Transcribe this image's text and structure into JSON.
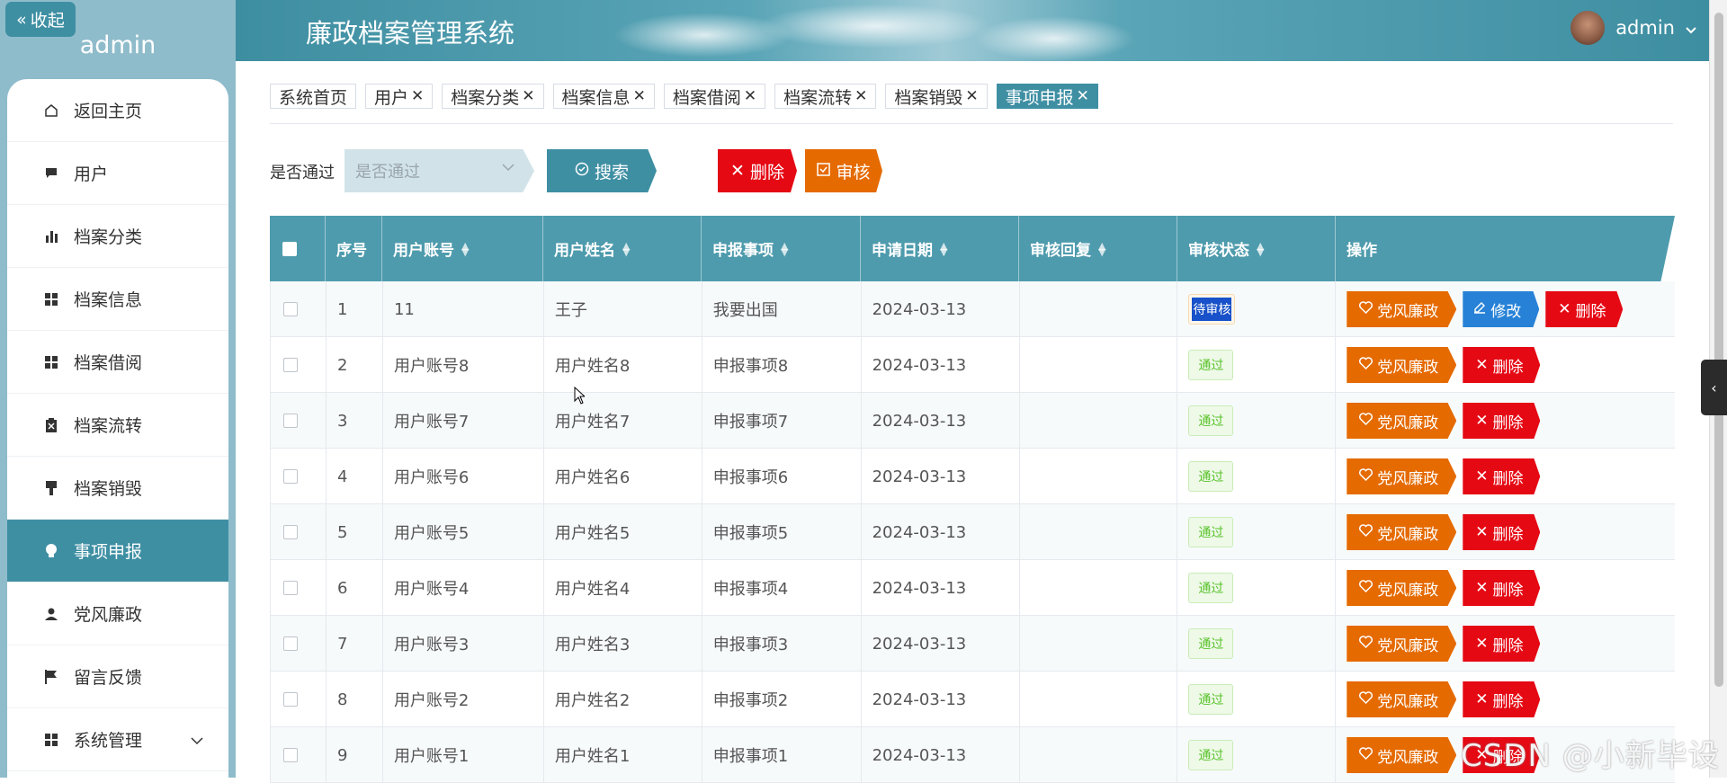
{
  "sidebar": {
    "collapse_label": "收起",
    "user_label": "admin",
    "items": [
      {
        "label": "返回主页",
        "icon": "home-icon"
      },
      {
        "label": "用户",
        "icon": "chat-icon"
      },
      {
        "label": "档案分类",
        "icon": "bar-chart-icon"
      },
      {
        "label": "档案信息",
        "icon": "grid-icon"
      },
      {
        "label": "档案借阅",
        "icon": "grid-icon"
      },
      {
        "label": "档案流转",
        "icon": "clipboard-icon"
      },
      {
        "label": "档案销毁",
        "icon": "brush-icon"
      },
      {
        "label": "事项申报",
        "icon": "lightbulb-icon",
        "active": true
      },
      {
        "label": "党风廉政",
        "icon": "person-icon"
      },
      {
        "label": "留言反馈",
        "icon": "flag-icon"
      },
      {
        "label": "系统管理",
        "icon": "grid-icon"
      }
    ]
  },
  "header": {
    "title": "廉政档案管理系统",
    "username": "admin"
  },
  "tabs": [
    "系统首页",
    "用户",
    "档案分类",
    "档案信息",
    "档案借阅",
    "档案流转",
    "档案销毁",
    "事项申报"
  ],
  "search": {
    "label": "是否通过",
    "placeholder": "是否通过",
    "search_button": "搜索",
    "delete_button": "删除",
    "audit_button": "审核"
  },
  "table": {
    "columns": [
      "序号",
      "用户账号",
      "用户姓名",
      "申报事项",
      "申请日期",
      "审核回复",
      "审核状态",
      "操作"
    ],
    "rows": [
      {
        "no": "1",
        "account": "11",
        "name": "王子",
        "item": "我要出国",
        "date": "2024-03-13",
        "reply": "",
        "status": "待审核"
      },
      {
        "no": "2",
        "account": "用户账号8",
        "name": "用户姓名8",
        "item": "申报事项8",
        "date": "2024-03-13",
        "reply": "",
        "status": "通过"
      },
      {
        "no": "3",
        "account": "用户账号7",
        "name": "用户姓名7",
        "item": "申报事项7",
        "date": "2024-03-13",
        "reply": "",
        "status": "通过"
      },
      {
        "no": "4",
        "account": "用户账号6",
        "name": "用户姓名6",
        "item": "申报事项6",
        "date": "2024-03-13",
        "reply": "",
        "status": "通过"
      },
      {
        "no": "5",
        "account": "用户账号5",
        "name": "用户姓名5",
        "item": "申报事项5",
        "date": "2024-03-13",
        "reply": "",
        "status": "通过"
      },
      {
        "no": "6",
        "account": "用户账号4",
        "name": "用户姓名4",
        "item": "申报事项4",
        "date": "2024-03-13",
        "reply": "",
        "status": "通过"
      },
      {
        "no": "7",
        "account": "用户账号3",
        "name": "用户姓名3",
        "item": "申报事项3",
        "date": "2024-03-13",
        "reply": "",
        "status": "通过"
      },
      {
        "no": "8",
        "account": "用户账号2",
        "name": "用户姓名2",
        "item": "申报事项2",
        "date": "2024-03-13",
        "reply": "",
        "status": "通过"
      },
      {
        "no": "9",
        "account": "用户账号1",
        "name": "用户姓名1",
        "item": "申报事项1",
        "date": "2024-03-13",
        "reply": "",
        "status": "通过"
      }
    ],
    "op_party": "党风廉政",
    "op_edit": "修改",
    "op_delete": "删除"
  },
  "watermark": "CSDN @小新毕设",
  "colors": {
    "primary": "#3f8fa3",
    "danger": "#e50914",
    "warning": "#e56a00",
    "edit": "#2782d7",
    "success": "#5ac32c"
  }
}
